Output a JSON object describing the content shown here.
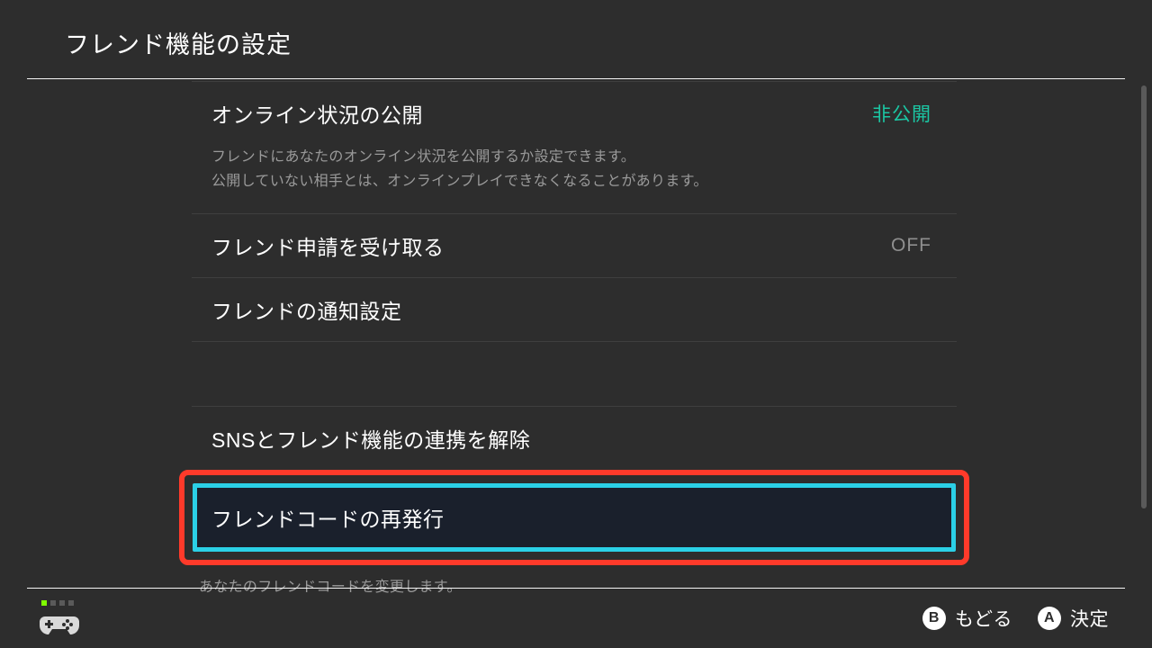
{
  "header": {
    "title": "フレンド機能の設定"
  },
  "rows": {
    "online_status": {
      "label": "オンライン状況の公開",
      "value": "非公開",
      "desc_line1": "フレンドにあなたのオンライン状況を公開するか設定できます。",
      "desc_line2": "公開していない相手とは、オンラインプレイできなくなることがあります。"
    },
    "friend_requests": {
      "label": "フレンド申請を受け取る",
      "value": "OFF"
    },
    "notifications": {
      "label": "フレンドの通知設定"
    },
    "sns_unlink": {
      "label": "SNSとフレンド機能の連携を解除"
    },
    "reissue_code": {
      "label": "フレンドコードの再発行",
      "desc": "あなたのフレンドコードを変更します。"
    }
  },
  "footer": {
    "b_label": "もどる",
    "a_label": "決定",
    "b_glyph": "B",
    "a_glyph": "A"
  }
}
